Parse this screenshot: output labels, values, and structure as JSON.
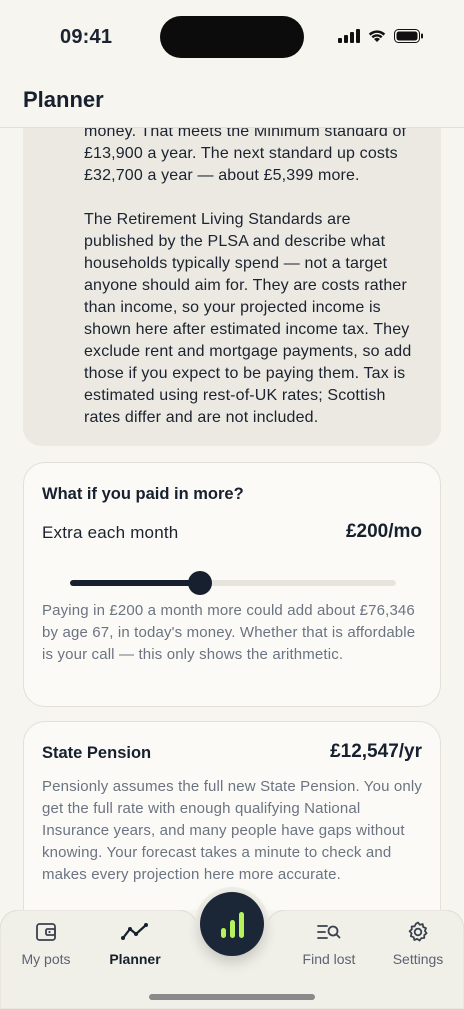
{
  "status": {
    "time": "09:41"
  },
  "header": {
    "title": "Planner"
  },
  "info_card": {
    "paragraph_1": "money. That meets the Minimum standard of £13,900 a year. The next standard up costs £32,700 a year — about £5,399 more.",
    "paragraph_2": "The Retirement Living Standards are published by the PLSA and describe what households typically spend — not a target anyone should aim for. They are costs rather than income, so your projected income is shown here after estimated income tax. They exclude rent and mortgage payments, so add those if you expect to be paying them. Tax is estimated using rest-of-UK rates; Scottish rates differ and are not included."
  },
  "what_if": {
    "title": "What if you paid in more?",
    "slider_label": "Extra each month",
    "slider_value": "£200/mo",
    "slider_fraction": 0.4,
    "body": "Paying in £200 a month more could add about £76,346 by age 67, in today's money. Whether that is affordable is your call — this only shows the arithmetic."
  },
  "state_pension": {
    "title": "State Pension",
    "value": "£12,547/yr",
    "body": "Pensionly assumes the full new State Pension. You only get the full rate with enough qualifying National Insurance years, and many people have gaps without knowing. Your forecast takes a minute to check and makes every projection here more accurate."
  },
  "tabbar": {
    "tabs": [
      {
        "label": "My pots",
        "icon": "wallet-icon",
        "active": false
      },
      {
        "label": "Planner",
        "icon": "trend-line-icon",
        "active": true
      },
      {
        "label": "Find lost",
        "icon": "search-list-icon",
        "active": false
      },
      {
        "label": "Settings",
        "icon": "gear-icon",
        "active": false
      }
    ],
    "center_icon": "bar-chart-icon"
  },
  "colors": {
    "background": "#f6f5ef",
    "ink": "#17202e",
    "muted_text": "#6b7482",
    "accent_green": "#b6f25c",
    "card_fill": "#fbfaf6",
    "info_fill": "#ebe9e1"
  }
}
